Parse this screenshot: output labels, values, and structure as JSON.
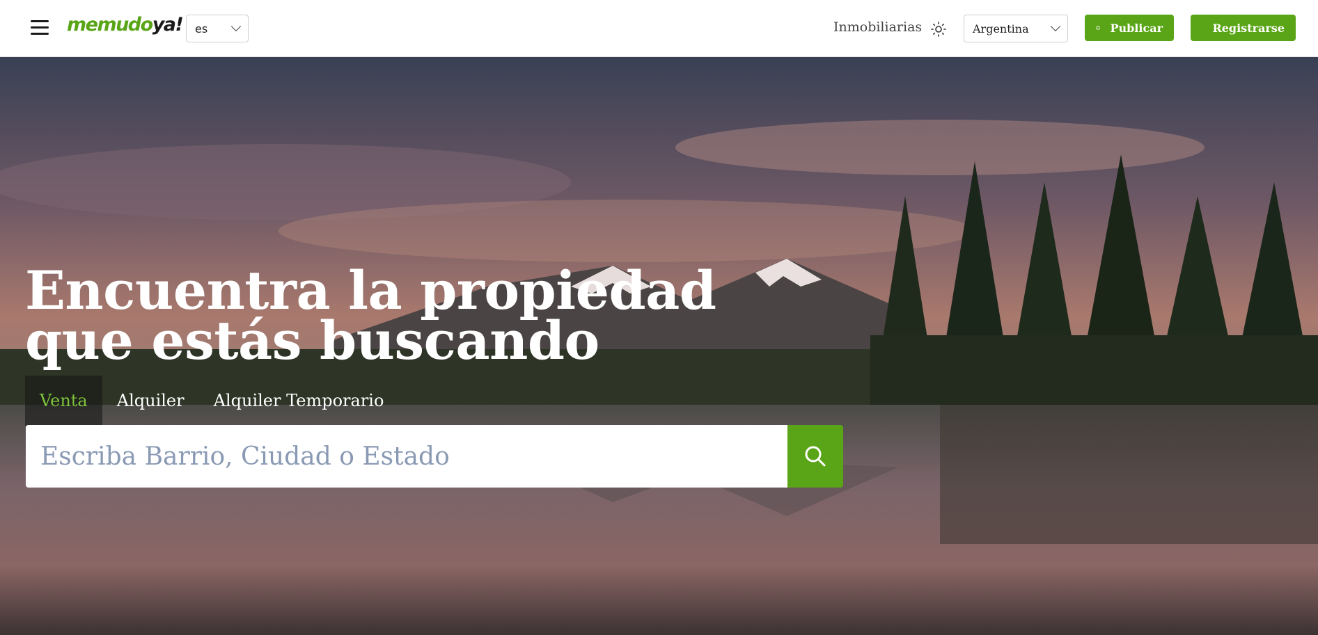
{
  "header": {
    "logo_text": "memudoya!",
    "language": {
      "value": "es"
    },
    "nav_link": "Inmobiliarias",
    "country": {
      "value": "Argentina"
    },
    "publish_label": "Publicar",
    "register_label": "Registrarse"
  },
  "hero": {
    "title_line1": "Encuentra la propiedad",
    "title_line2": "que estás buscando",
    "tabs": [
      {
        "label": "Venta",
        "active": true
      },
      {
        "label": "Alquiler",
        "active": false
      },
      {
        "label": "Alquiler Temporario",
        "active": false
      }
    ],
    "search": {
      "placeholder": "Escriba Barrio, Ciudad o Estado",
      "value": ""
    }
  },
  "colors": {
    "accent": "#5aa517",
    "active_tab_text": "#7cc23a",
    "placeholder": "#8a9ab4"
  },
  "icons": {
    "menu": "hamburger-icon",
    "theme": "sun-icon",
    "publish": "briefcase-icon",
    "register": "login-icon",
    "search": "search-icon"
  }
}
